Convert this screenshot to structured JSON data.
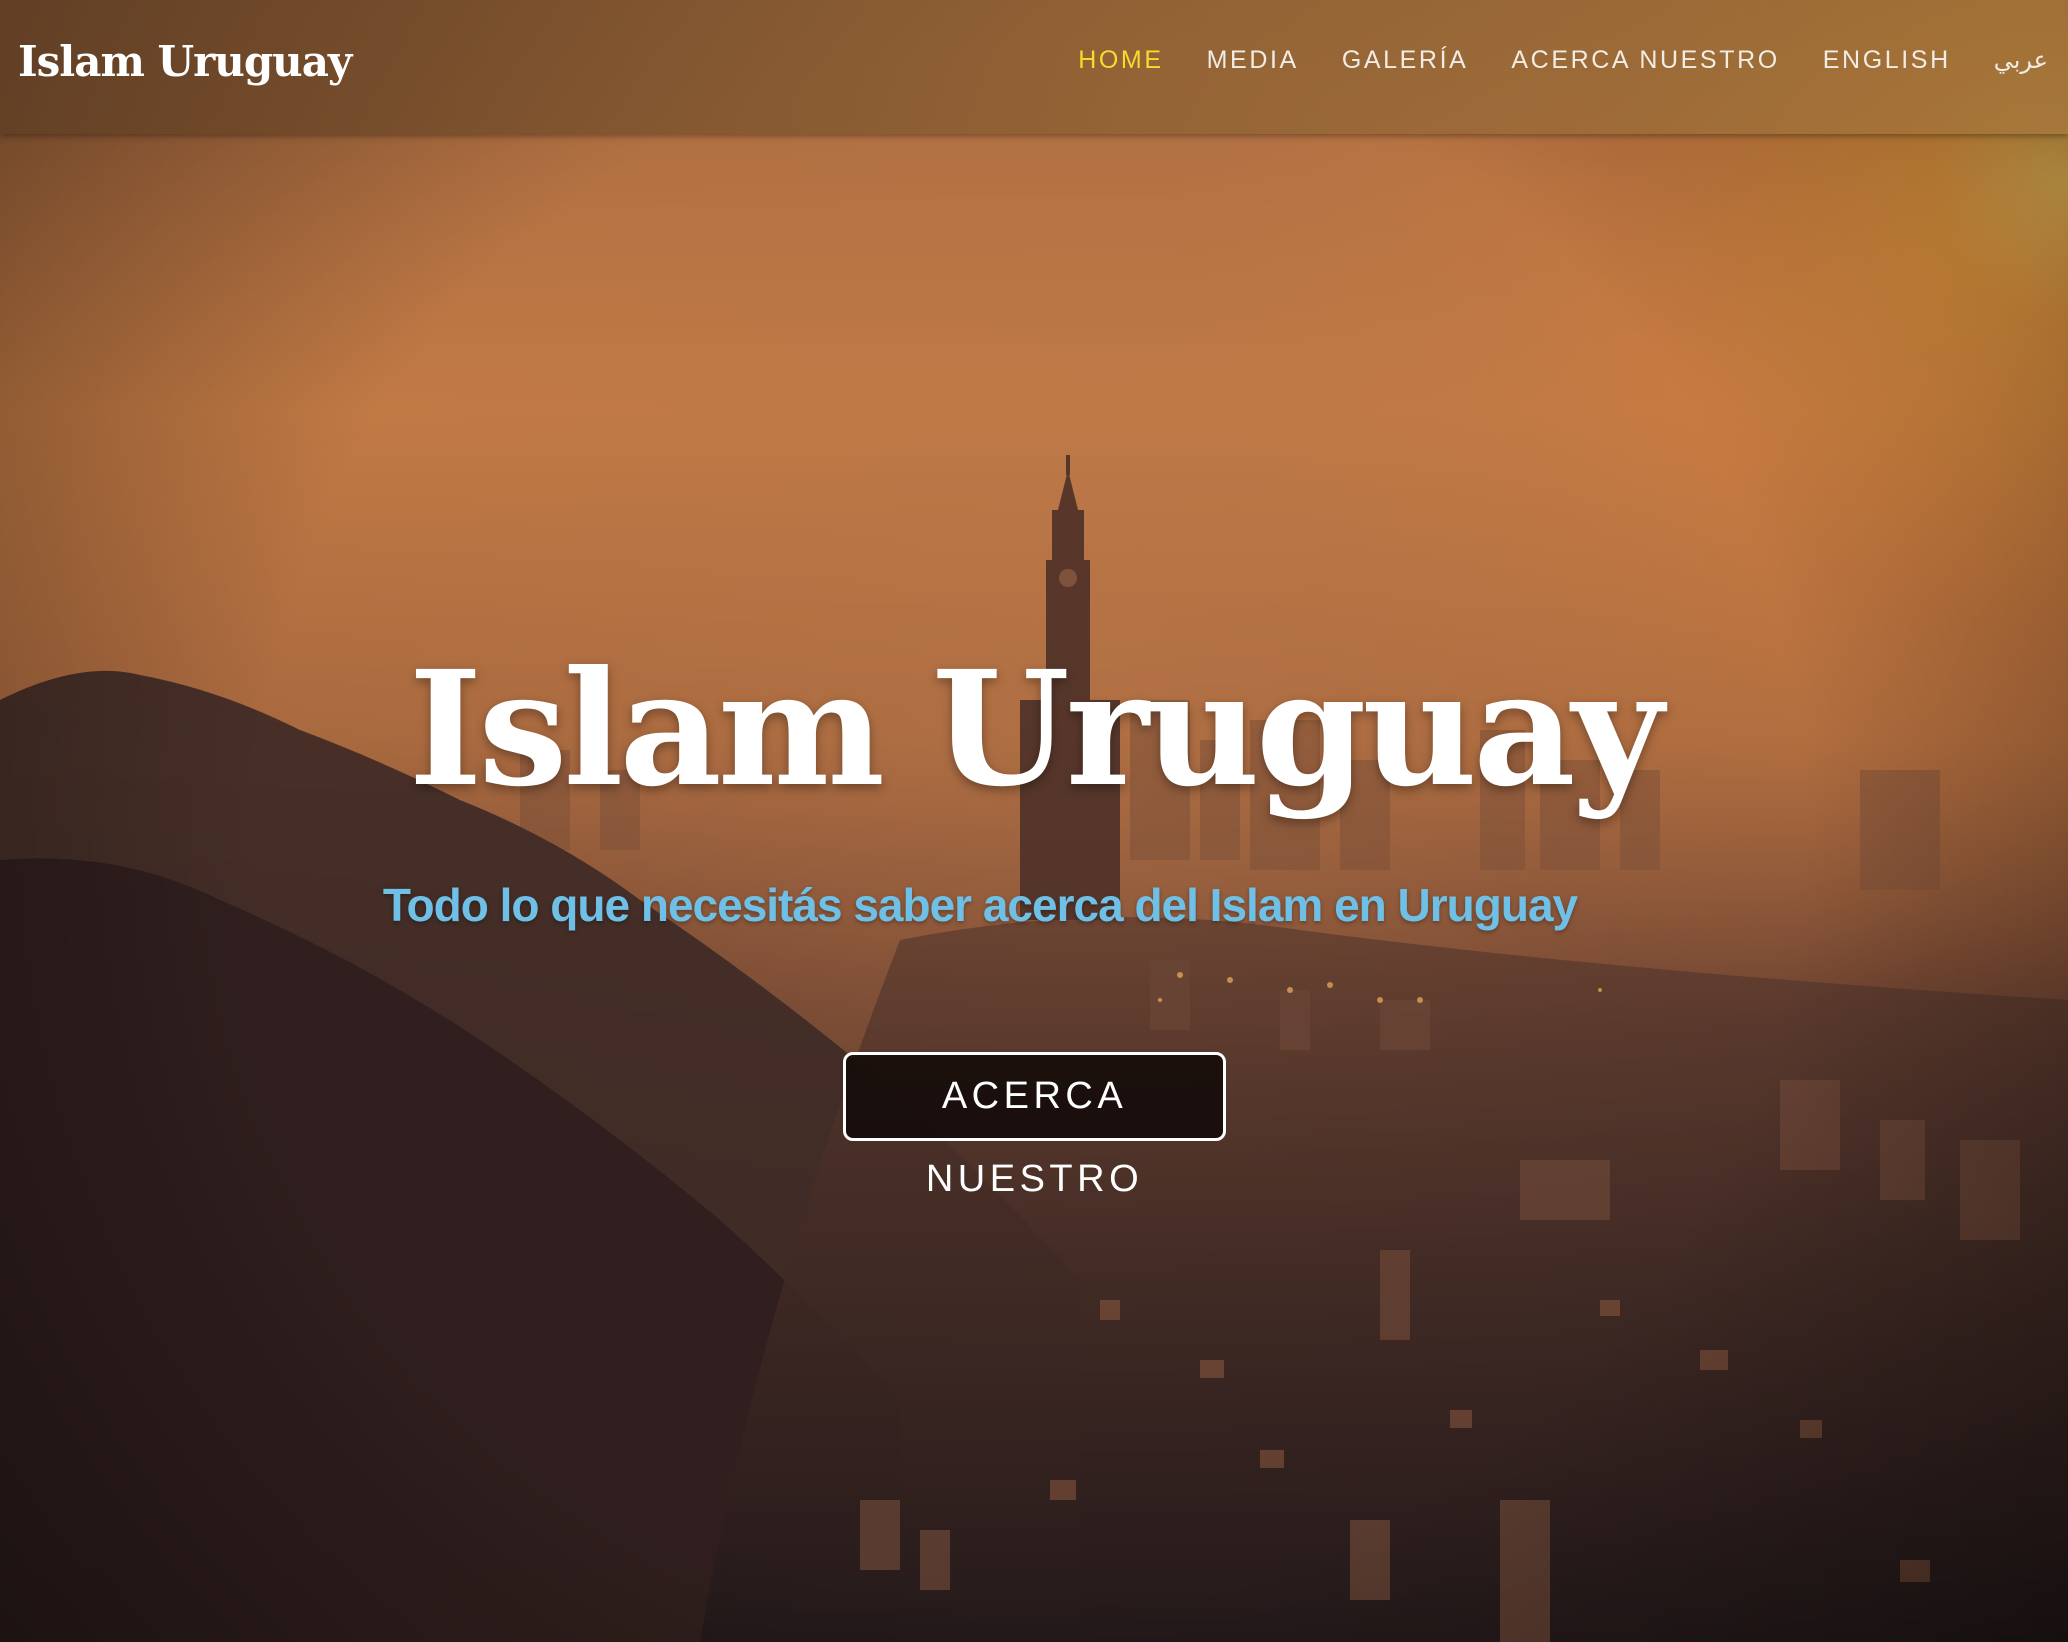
{
  "header": {
    "brand": "Islam Uruguay",
    "nav": [
      {
        "label": "HOME",
        "active": true
      },
      {
        "label": "MEDIA",
        "active": false
      },
      {
        "label": "GALERÍA",
        "active": false
      },
      {
        "label": "ACERCA NUESTRO",
        "active": false
      },
      {
        "label": "ENGLISH",
        "active": false
      },
      {
        "label": "عربي",
        "active": false
      }
    ]
  },
  "hero": {
    "title": "Islam Uruguay",
    "subtitle": "Todo lo que necesitás saber acerca del Islam en Uruguay",
    "cta_label": "ACERCA NUESTRO",
    "background": "aerial-city-sunset-photo"
  },
  "colors": {
    "nav_active": "#f3dc2e",
    "nav_text": "#f1ece4",
    "subtitle": "#6fc0e6",
    "title": "#ffffff",
    "sky_top": "#c07a48",
    "sun": "#f4b24e"
  }
}
